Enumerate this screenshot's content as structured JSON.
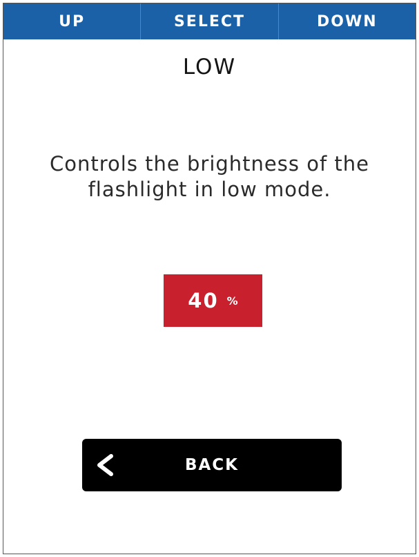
{
  "topbar": {
    "up_label": "UP",
    "select_label": "SELECT",
    "down_label": "DOWN",
    "color": "#1b61a8"
  },
  "screen": {
    "title": "LOW",
    "description": "Controls the brightness of the flashlight in low mode."
  },
  "value": {
    "number": "40",
    "unit": "%",
    "color": "#c8202d"
  },
  "back_button": {
    "label": "BACK",
    "icon": "chevron-left-icon",
    "color": "#000000"
  }
}
